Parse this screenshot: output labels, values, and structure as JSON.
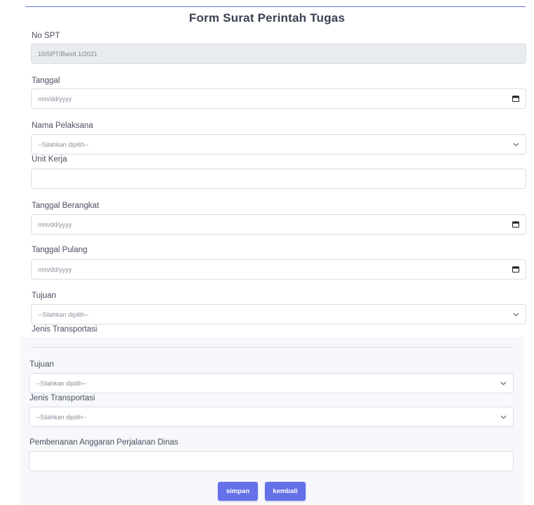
{
  "title": "Form Surat Perintah Tugas",
  "form": {
    "no_spt": {
      "label": "No SPT",
      "value": "10/SPT/Bws9.1/2021"
    },
    "tanggal": {
      "label": "Tanggal",
      "placeholder": "mm/dd/yyyy"
    },
    "nama_pelaksana": {
      "label": "Nama Pelaksana",
      "selected": "--Silahkan dipilih--"
    },
    "unit_kerja": {
      "label": "Unit Kerja",
      "value": ""
    },
    "tanggal_berangkat": {
      "label": "Tanggal Berangkat",
      "placeholder": "mm/dd/yyyy"
    },
    "tanggal_pulang": {
      "label": "Tanggal Pulang",
      "placeholder": "mm/dd/yyyy"
    },
    "tujuan": {
      "label": "Tujuan",
      "selected": "--Silahkan dipilih--"
    },
    "jenis_transportasi": {
      "label": "Jenis Transportasi"
    }
  },
  "panel": {
    "tujuan": {
      "label": "Tujuan",
      "selected": "--Silahkan dipilih--"
    },
    "jenis_transportasi": {
      "label": "Jenis Transportasi",
      "selected": "--Silahkan dipilih--"
    },
    "pembebanan": {
      "label": "Pembenanan Anggaran Perjalanan Dinas",
      "value": ""
    }
  },
  "buttons": {
    "simpan": "simpan",
    "kembali": "kembali"
  },
  "colors": {
    "accent": "#6571e8",
    "readonly_bg": "#e9ecef",
    "border": "#d9dde5"
  },
  "icons": {
    "date": "calendar-icon",
    "select": "chevron-down-icon"
  }
}
